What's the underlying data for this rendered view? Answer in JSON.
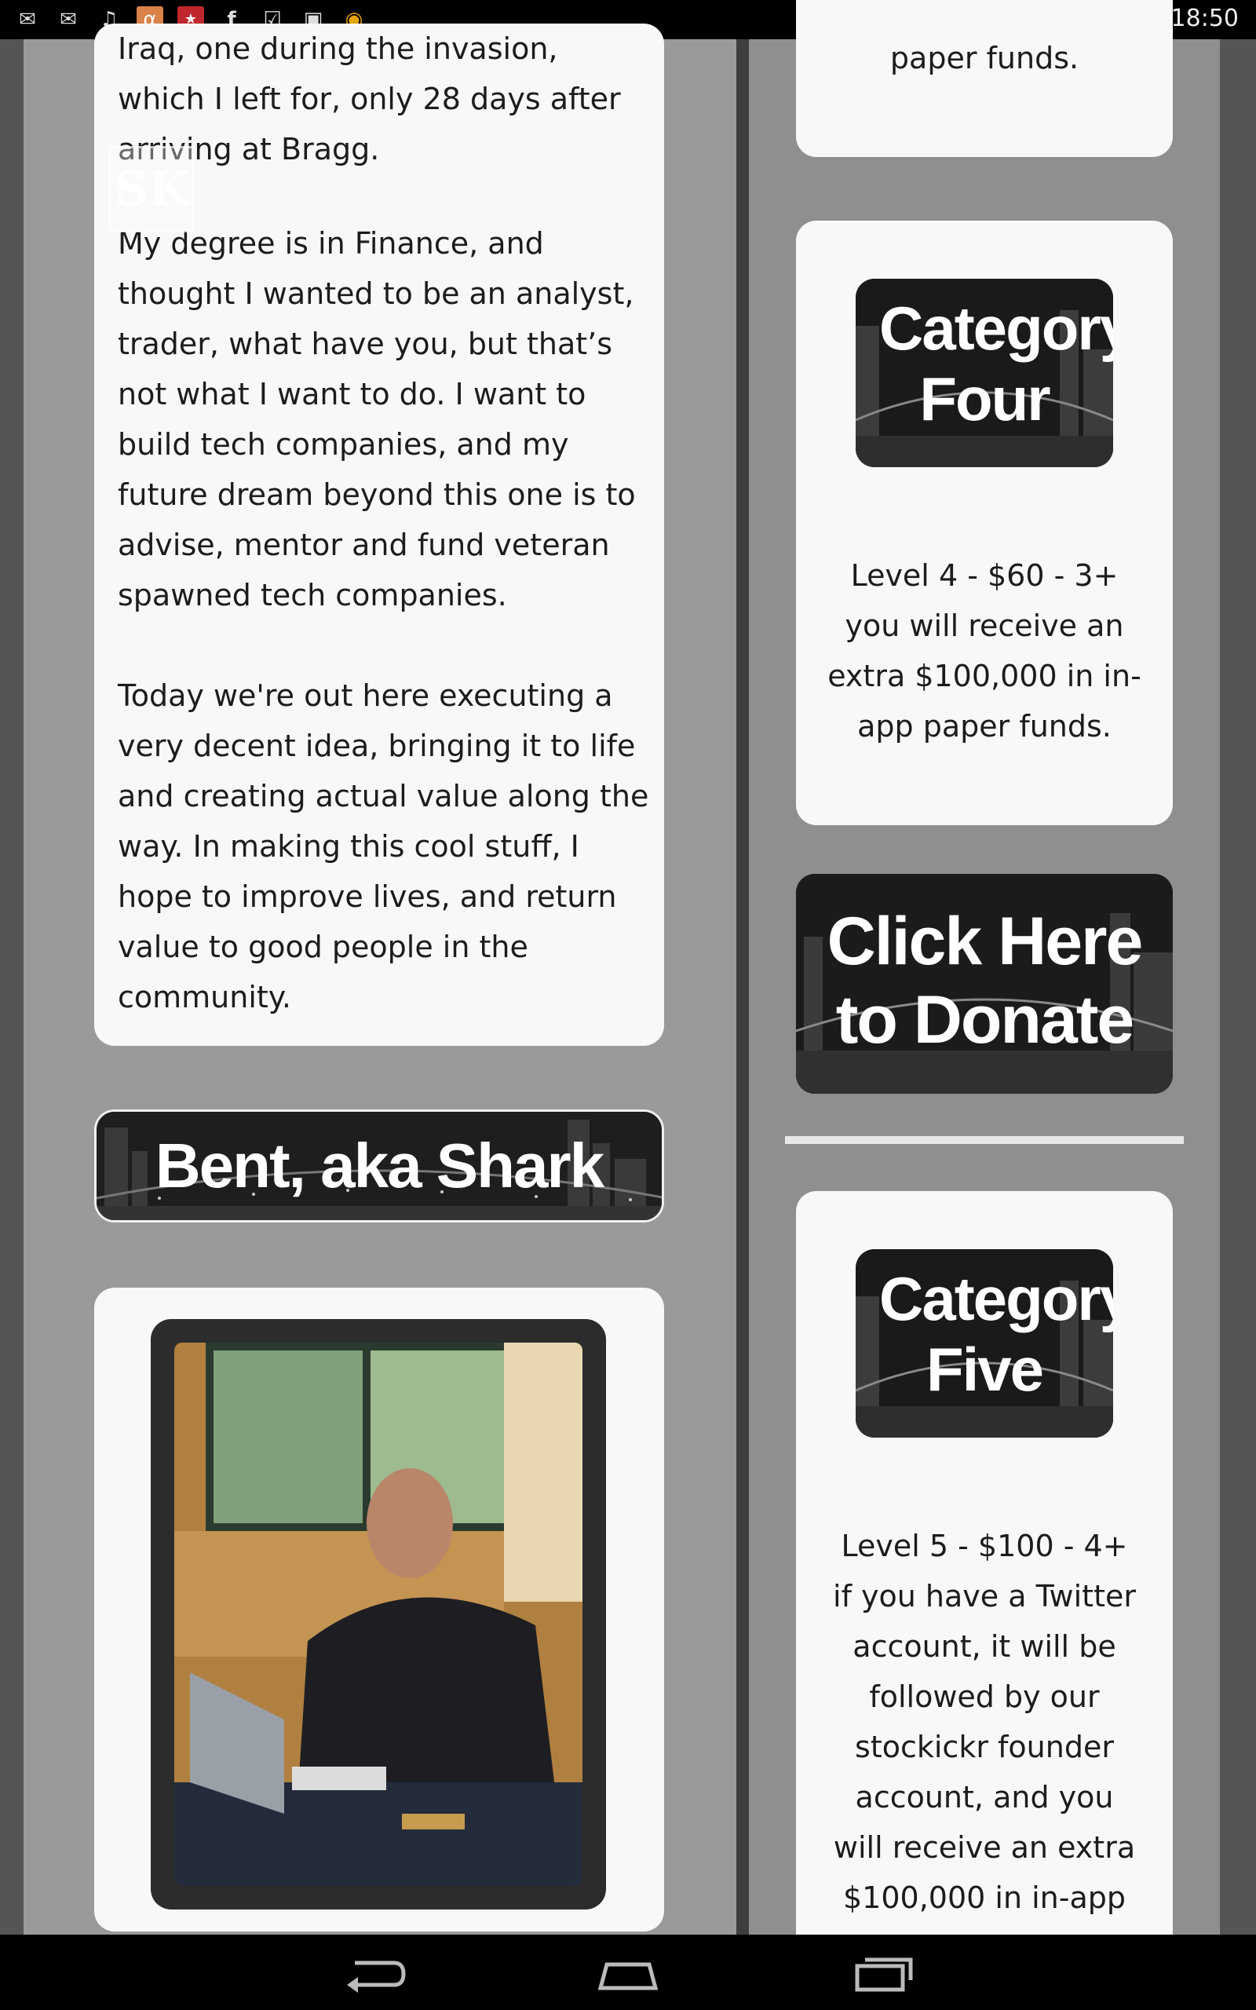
{
  "status_bar": {
    "time": "18:50",
    "left_icons": [
      "gmail-icon",
      "gmail-icon",
      "music-icon",
      "alpha-icon",
      "nfl-icon",
      "facebook-icon",
      "checklist-icon",
      "shopping-bag-icon",
      "game-icon"
    ],
    "right_icons": [
      "wifi-icon",
      "battery-icon"
    ]
  },
  "left_column": {
    "story_top": "Iraq, one during the invasion, which I left for, only 28 days after arriving at Bragg.",
    "story_p2": "My degree is in Finance, and thought I wanted to be an analyst, trader, what have you, but that’s not what I want to do. I want to build tech companies, and my future dream beyond this one is to advise, mentor and fund veteran spawned tech companies.",
    "story_p3": "Today we're out here executing a very decent idea, bringing it to life and creating actual value along the way. In making this cool stuff, I hope to improve lives, and return value to good people in the community.",
    "logo_text": "SK",
    "profile_banner": "Bent, aka Shark"
  },
  "right_column": {
    "top_card_tail": "paper funds.",
    "category_four_title": "Category Four",
    "category_four_text": "Level 4 - $60 - 3+ you will receive an extra $100,000 in in-app paper funds.",
    "donate_button": "Click Here to Donate",
    "category_five_title": "Category Five",
    "category_five_text": "Level 5 - $100 - 4+ if you have a Twitter account, it will be followed by our stockickr founder account, and you will receive an extra $100,000 in in-app"
  },
  "nav_bar": {
    "buttons": [
      "back-icon",
      "home-icon",
      "recent-apps-icon"
    ]
  }
}
